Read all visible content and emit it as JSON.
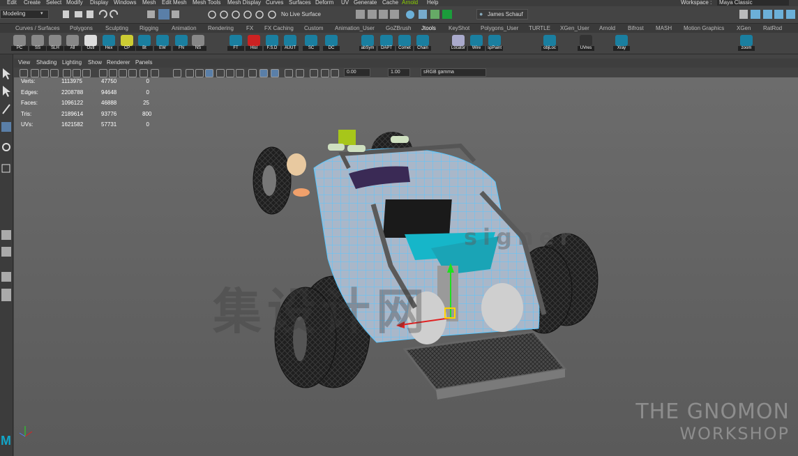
{
  "menubar": {
    "items": [
      "Edit",
      "Create",
      "Select",
      "Modify",
      "Display",
      "Windows",
      "Mesh",
      "Edit Mesh",
      "Mesh Tools",
      "Mesh Display",
      "Curves",
      "Surfaces",
      "Deform",
      "UV",
      "Generate",
      "Cache",
      "Arnold",
      "Help"
    ],
    "workspace_label": "Workspace :",
    "workspace_value": "Maya Classic"
  },
  "statusline": {
    "mode": "Modeling",
    "live_surface": "No Live Surface",
    "user": "James Schauf"
  },
  "shelf": {
    "tabs": [
      "Curves / Surfaces",
      "Polygons",
      "Sculpting",
      "Rigging",
      "Animation",
      "Rendering",
      "FX",
      "FX Caching",
      "Custom",
      "Animation_User",
      "GoZBrush",
      "Jtools",
      "KeyShot",
      "Polygons_User",
      "TURTLE",
      "XGen_User",
      "Arnold",
      "Bifrost",
      "MASH",
      "Motion Graphics",
      "XGen",
      "RatRod"
    ],
    "active_tab": "Jtools",
    "icon_labels": [
      "PC",
      "SS",
      "SLH",
      "All",
      "Outl",
      "Hex",
      "CP",
      "Bt",
      "EW",
      "FN",
      "NS",
      "FT",
      "Hisl",
      "F.S.D",
      "AUUT",
      "SC",
      "DC",
      "abSym",
      "DAPT",
      "Comet",
      "Chain",
      "Locator",
      "Wire",
      "spPaint",
      "objLoc",
      "UVres",
      "Xray",
      "zoom"
    ]
  },
  "panel": {
    "menu": [
      "View",
      "Shading",
      "Lighting",
      "Show",
      "Renderer",
      "Panels"
    ],
    "exposure": "0.00",
    "gamma": "1.00",
    "color_space": "sRGB gamma"
  },
  "hud": {
    "rows": [
      {
        "label": "Verts:",
        "a": "1113975",
        "b": "47750",
        "c": "0"
      },
      {
        "label": "Edges:",
        "a": "2208788",
        "b": "94648",
        "c": "0"
      },
      {
        "label": "Faces:",
        "a": "1096122",
        "b": "46888",
        "c": "25"
      },
      {
        "label": "Tris:",
        "a": "2189614",
        "b": "93776",
        "c": "800"
      },
      {
        "label": "UVs:",
        "a": "1621582",
        "b": "57731",
        "c": "0"
      }
    ]
  },
  "watermark": {
    "line1": "THE GNOMON",
    "line2": "WORKSHOP",
    "cn": "集设计网",
    "en": "signer"
  },
  "colors": {
    "accent": "#5a9bd4",
    "teal": "#16b6c9",
    "wire": "#59c7ff"
  }
}
